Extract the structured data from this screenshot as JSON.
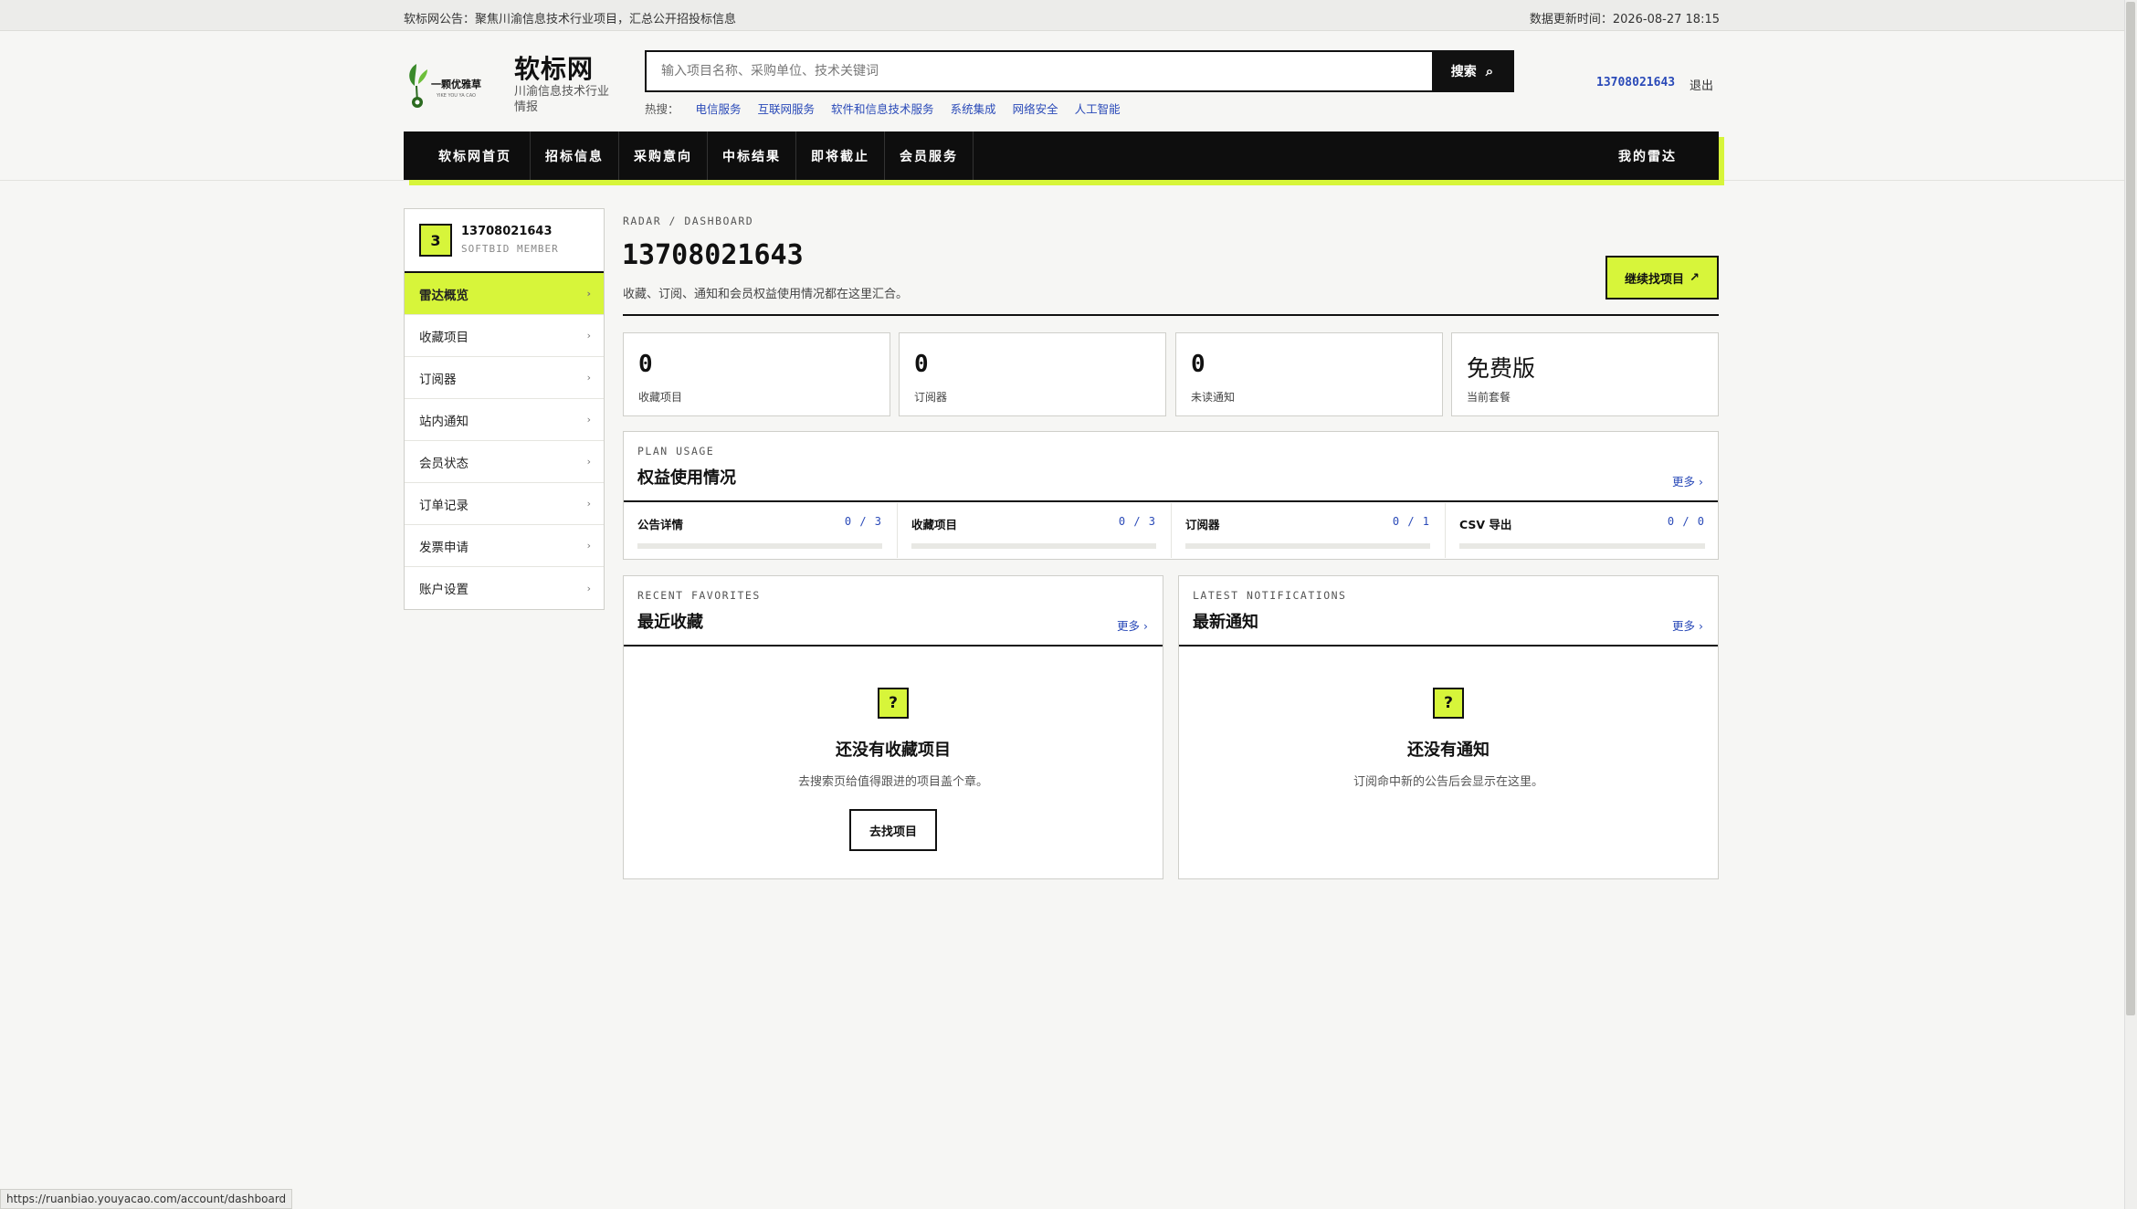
{
  "topbar": {
    "announcement": "软标网公告：聚焦川渝信息技术行业项目，汇总公开招投标信息",
    "updated": "数据更新时间：2026-08-27 18:15"
  },
  "brand": {
    "logo_text": "一颗优雅草",
    "logo_sub": "YIKE YOU YA CAO",
    "title": "软标网",
    "subtitle": "川渝信息技术行业情报"
  },
  "search": {
    "placeholder": "输入项目名称、采购单位、技术关键词",
    "button_label": "搜索",
    "hot_label": "热搜：",
    "hot_terms": [
      "电信服务",
      "互联网服务",
      "软件和信息技术服务",
      "系统集成",
      "网络安全",
      "人工智能"
    ]
  },
  "account": {
    "user_id": "13708021643",
    "logout_label": "退出"
  },
  "nav": {
    "items": [
      "软标网首页",
      "招标信息",
      "采购意向",
      "中标结果",
      "即将截止",
      "会员服务"
    ],
    "my_radar": "我的雷达"
  },
  "sidebar": {
    "badge": "3",
    "name": "13708021643",
    "role": "SOFTBID MEMBER",
    "items": [
      {
        "label": "雷达概览",
        "active": true
      },
      {
        "label": "收藏项目",
        "active": false
      },
      {
        "label": "订阅器",
        "active": false
      },
      {
        "label": "站内通知",
        "active": false
      },
      {
        "label": "会员状态",
        "active": false
      },
      {
        "label": "订单记录",
        "active": false
      },
      {
        "label": "发票申请",
        "active": false
      },
      {
        "label": "账户设置",
        "active": false
      }
    ]
  },
  "page": {
    "breadcrumb": "RADAR / DASHBOARD",
    "title": "13708021643",
    "description": "收藏、订阅、通知和会员权益使用情况都在这里汇合。",
    "continue_button": "继续找项目",
    "continue_icon": "↗"
  },
  "stats": [
    {
      "value": "0",
      "label": "收藏项目"
    },
    {
      "value": "0",
      "label": "订阅器"
    },
    {
      "value": "0",
      "label": "未读通知"
    },
    {
      "value": "免费版",
      "label": "当前套餐"
    }
  ],
  "usage": {
    "eyebrow": "PLAN USAGE",
    "title": "权益使用情况",
    "more": "更多 ›",
    "items": [
      {
        "name": "公告详情",
        "count": "0 / 3",
        "fraction": 0
      },
      {
        "name": "收藏项目",
        "count": "0 / 3",
        "fraction": 0
      },
      {
        "name": "订阅器",
        "count": "0 / 1",
        "fraction": 0
      },
      {
        "name": "CSV 导出",
        "count": "0 / 0",
        "fraction": 0
      }
    ]
  },
  "favorites": {
    "eyebrow": "RECENT FAVORITES",
    "title": "最近收藏",
    "more": "更多 ›",
    "empty_icon": "?",
    "empty_title": "还没有收藏项目",
    "empty_desc": "去搜索页给值得跟进的项目盖个章。",
    "empty_button": "去找项目"
  },
  "notifications": {
    "eyebrow": "LATEST NOTIFICATIONS",
    "title": "最新通知",
    "more": "更多 ›",
    "empty_icon": "?",
    "empty_title": "还没有通知",
    "empty_desc": "订阅命中新的公告后会显示在这里。"
  },
  "statusbar": {
    "url": "https://ruanbiao.youyacao.com/account/dashboard"
  },
  "colors": {
    "accent": "#d7f53a",
    "dark": "#0e0e0e",
    "link": "#2a4ab8"
  }
}
